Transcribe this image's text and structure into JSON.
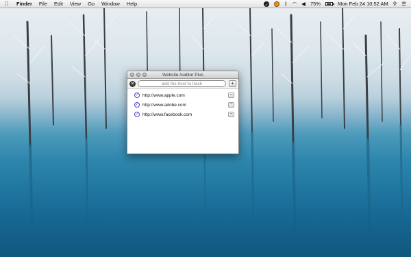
{
  "menubar": {
    "apple_icon": "apple-icon",
    "app_menu": "Finder",
    "menus": [
      "File",
      "Edit",
      "View",
      "Go",
      "Window",
      "Help"
    ],
    "battery_percent": "75%",
    "datetime": "Mon Feb 24  10:52 AM",
    "status_icons": [
      "app-status-icon",
      "orange-status-icon",
      "bluetooth-icon",
      "wifi-icon",
      "volume-icon",
      "battery-icon",
      "search-icon",
      "list-icon"
    ]
  },
  "window": {
    "title": "Website Auditor Plus",
    "search_placeholder": "add the host to track",
    "clear_label": "✕",
    "add_label": "+",
    "remove_label": "−",
    "check_label": "✓",
    "sites": [
      {
        "url": "http://www.apple.com",
        "tracked": true
      },
      {
        "url": "http://www.adobe.com",
        "tracked": true
      },
      {
        "url": "http://www.facebook.com",
        "tracked": true
      }
    ]
  },
  "colors": {
    "check_accent": "#4a44c7",
    "water": "#1f76a0",
    "snow": "#e9eef2"
  }
}
